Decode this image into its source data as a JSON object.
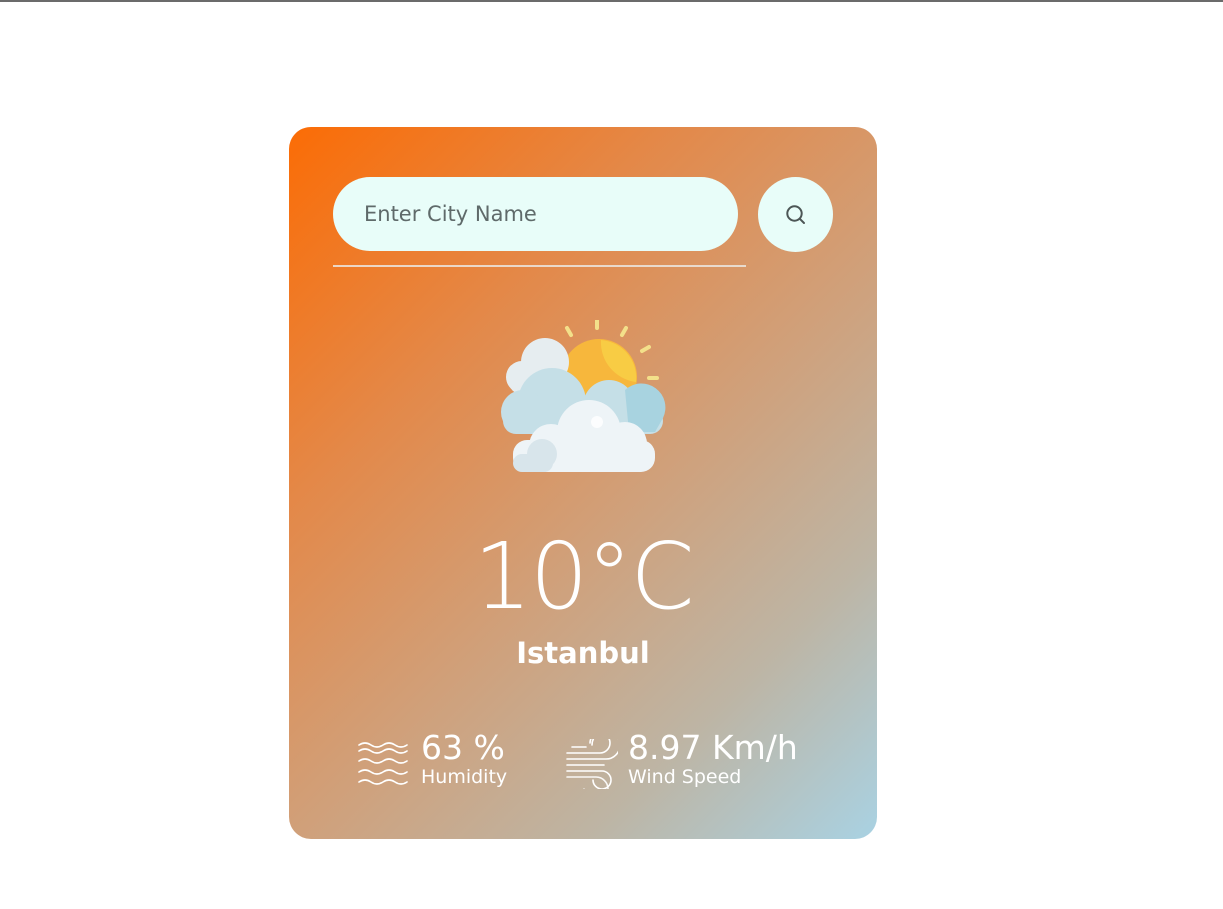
{
  "search": {
    "placeholder": "Enter City Name",
    "value": "",
    "button_icon": "search-icon"
  },
  "weather": {
    "icon": "partly-cloudy-icon",
    "temperature": "10°C",
    "city": "Istanbul"
  },
  "details": {
    "humidity": {
      "icon": "humidity-waves-icon",
      "value": "63 %",
      "label": "Humidity"
    },
    "wind": {
      "icon": "wind-icon",
      "value": "8.97 Km/h",
      "label": "Wind Speed"
    }
  },
  "colors": {
    "gradient_start": "#fb6c05",
    "gradient_end": "#a9d2e3",
    "input_background": "#e8fdf9",
    "text": "#ffffff"
  }
}
